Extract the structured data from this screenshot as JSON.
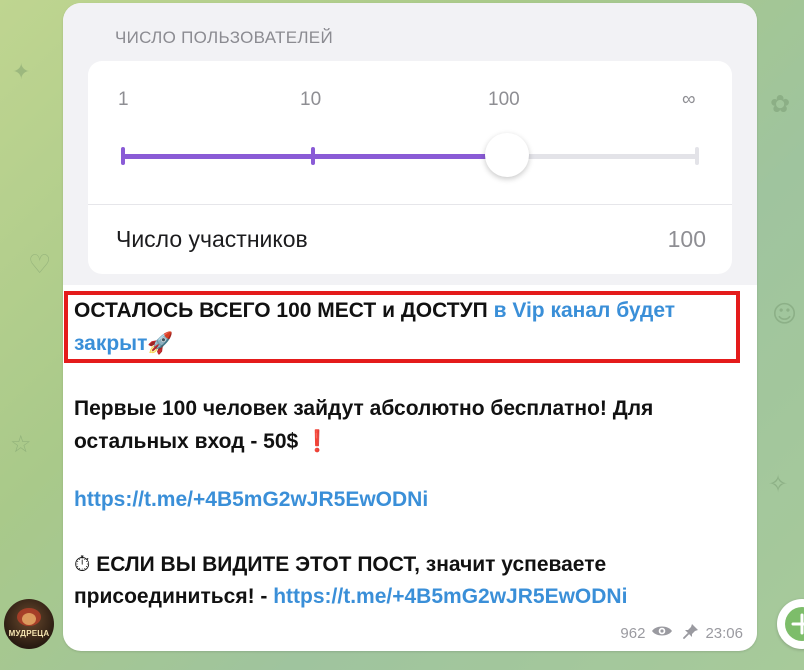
{
  "poll": {
    "title": "ЧИСЛО ПОЛЬЗОВАТЕЛЕЙ",
    "ticks": [
      "1",
      "10",
      "100",
      "∞"
    ],
    "slider_level_fraction": 0.667,
    "row_label": "Число участников",
    "row_value": "100",
    "accent_color": "#8a5bd6"
  },
  "message": {
    "line1_plain": "ОСТАЛОСЬ ВСЕГО 100 МЕСТ и ДОСТУП",
    "line1_link_a": "в Vip канал будет",
    "line1_link_b": "закрыт",
    "line1_emoji": "🚀",
    "para2_line1": "Первые 100 человек зайдут абсолютно бесплатно! Для",
    "para2_line2": "остальных вход - 50$",
    "para2_emoji": "❗",
    "link1": "https://t.me/+4B5mG2wJR5EwODNi",
    "para4_emoji": "⏱",
    "para4_line1": "ЕСЛИ ВЫ ВИДИТЕ ЭТОТ ПОСТ, значит успеваете",
    "para4_line2": "присоединиться! -",
    "link2": "https://t.me/+4B5mG2wJR5EwODNi",
    "highlight_color": "#e41b1b"
  },
  "meta": {
    "views": "962",
    "views_icon": "eye-icon",
    "pin_icon": "pin-icon",
    "time": "23:06"
  },
  "avatar": {
    "text": "МУДРЕЦА"
  }
}
